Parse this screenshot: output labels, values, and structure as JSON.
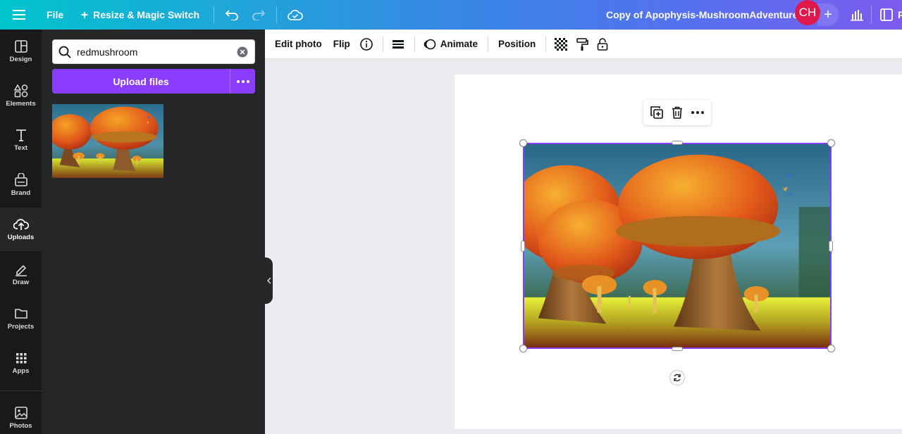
{
  "topbar": {
    "file_label": "File",
    "resize_label": "Resize & Magic Switch",
    "doc_title": "Copy of Apophysis-MushroomAdventure",
    "avatar_initials": "CH",
    "plus_label": "+",
    "cut_label": "R"
  },
  "nav": {
    "items": [
      {
        "label": "Design",
        "icon": "layout-icon"
      },
      {
        "label": "Elements",
        "icon": "shapes-icon"
      },
      {
        "label": "Text",
        "icon": "text-icon"
      },
      {
        "label": "Brand",
        "icon": "brand-icon"
      },
      {
        "label": "Uploads",
        "icon": "cloud-upload-icon"
      },
      {
        "label": "Draw",
        "icon": "pen-icon"
      },
      {
        "label": "Projects",
        "icon": "folder-icon"
      },
      {
        "label": "Apps",
        "icon": "grid-icon"
      },
      {
        "label": "Photos",
        "icon": "image-icon"
      }
    ],
    "active": "Uploads"
  },
  "panel": {
    "search_value": "redmushroom",
    "upload_label": "Upload files"
  },
  "toolbar": {
    "edit_photo": "Edit photo",
    "flip": "Flip",
    "animate": "Animate",
    "position": "Position"
  },
  "colors": {
    "accent": "#8b3dff",
    "avatar": "#e0194d",
    "rail": "#18191b",
    "panel": "#252627"
  }
}
